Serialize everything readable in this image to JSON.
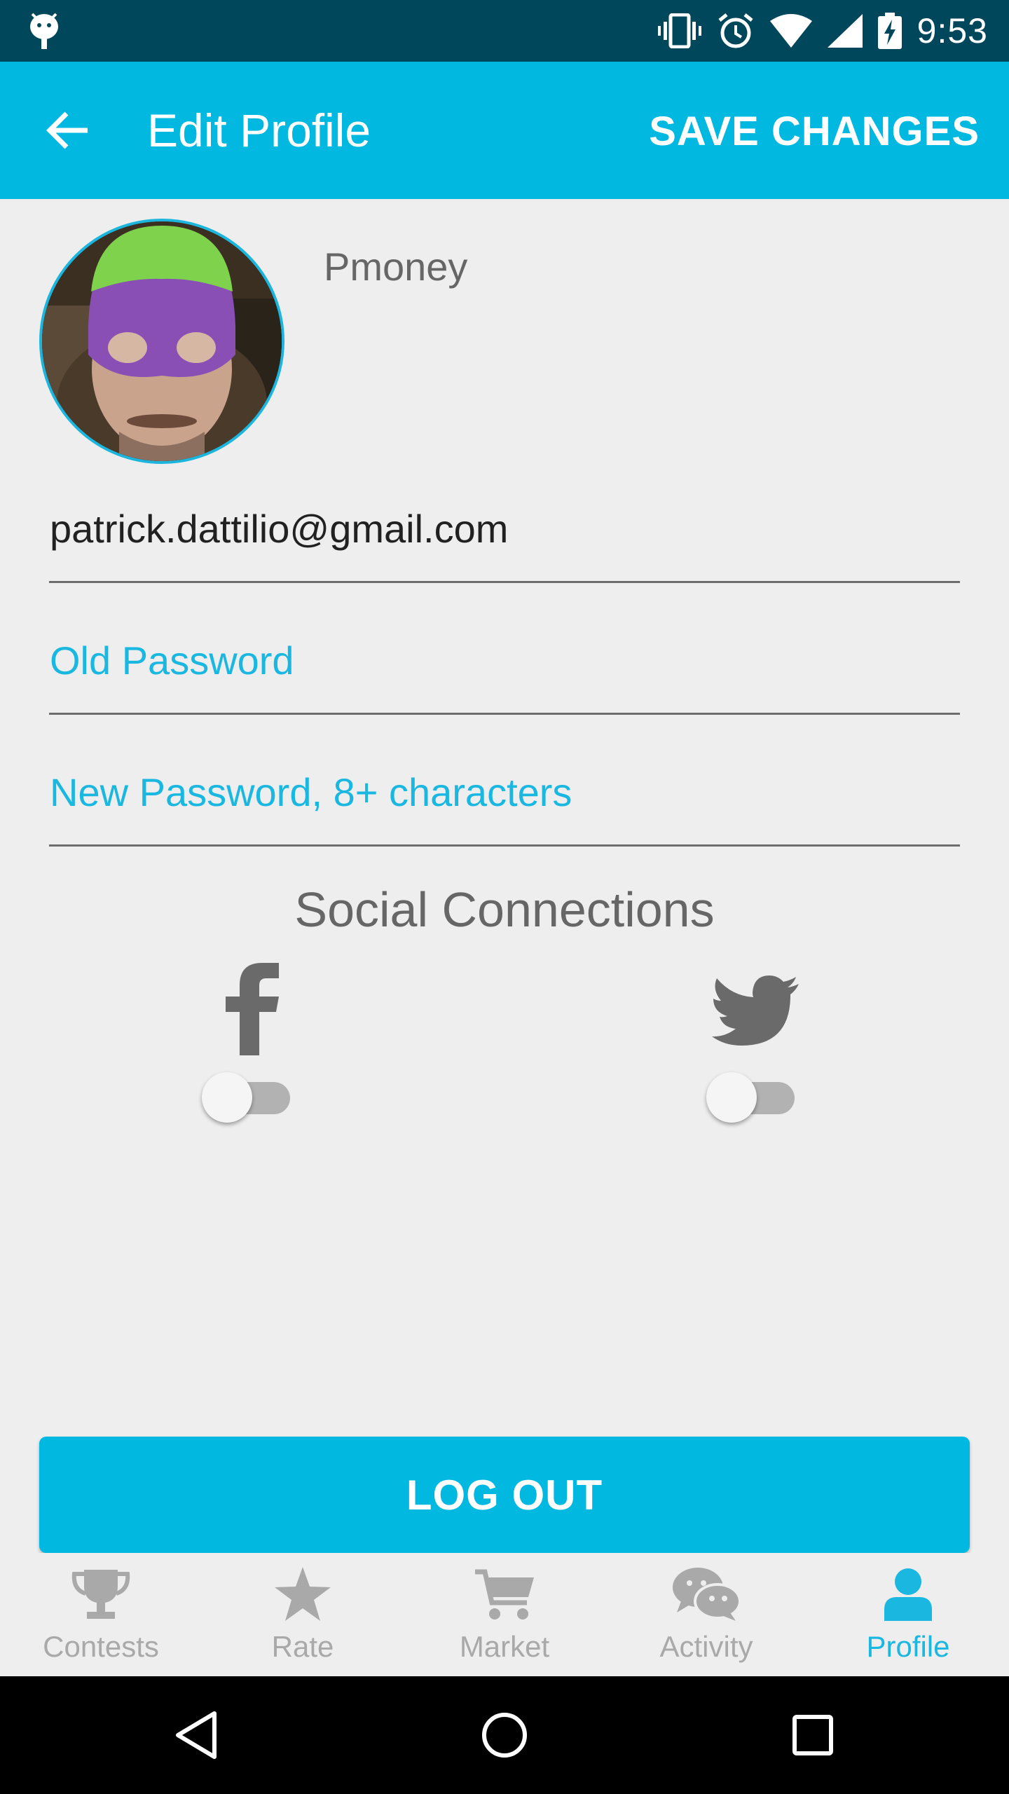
{
  "status_bar": {
    "time": "9:53",
    "icons": [
      "android-debug-icon",
      "vibrate-icon",
      "alarm-icon",
      "wifi-icon",
      "signal-icon",
      "battery-charging-icon"
    ]
  },
  "app_bar": {
    "title": "Edit Profile",
    "save_label": "SAVE CHANGES",
    "back_icon": "arrow-back-icon"
  },
  "profile": {
    "username": "Pmoney"
  },
  "form": {
    "email_value": "patrick.dattilio@gmail.com",
    "old_password_placeholder": "Old Password",
    "new_password_placeholder": "New Password, 8+ characters"
  },
  "social": {
    "title": "Social Connections",
    "facebook": {
      "icon": "facebook-icon",
      "enabled": false
    },
    "twitter": {
      "icon": "twitter-icon",
      "enabled": false
    }
  },
  "logout_label": "LOG OUT",
  "bottom_nav": {
    "items": [
      {
        "label": "Contests",
        "icon": "trophy-icon",
        "active": false
      },
      {
        "label": "Rate",
        "icon": "star-icon",
        "active": false
      },
      {
        "label": "Market",
        "icon": "cart-icon",
        "active": false
      },
      {
        "label": "Activity",
        "icon": "chat-icon",
        "active": false
      },
      {
        "label": "Profile",
        "icon": "person-icon",
        "active": true
      }
    ]
  },
  "colors": {
    "status_bar": "#01475c",
    "accent": "#00b8e0",
    "background": "#eeeeee",
    "inactive": "#a9a9a9"
  }
}
